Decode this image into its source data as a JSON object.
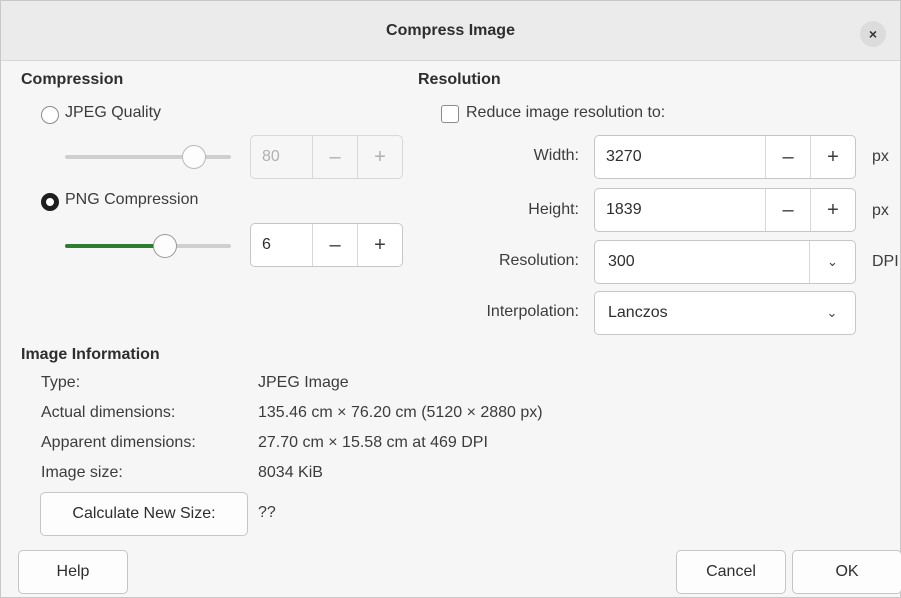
{
  "title": "Compress Image",
  "close_glyph": "×",
  "compression": {
    "heading": "Compression",
    "jpeg_label": "JPEG Quality",
    "jpeg_value": "80",
    "jpeg_slider_fraction": 0.8,
    "png_label": "PNG Compression",
    "png_value": "6",
    "png_slider_fraction": 0.6,
    "selected": "png"
  },
  "resolution": {
    "heading": "Resolution",
    "reduce_label": "Reduce image resolution to:",
    "reduce_checked": false,
    "width_label": "Width:",
    "width_value": "3270",
    "width_unit": "px",
    "height_label": "Height:",
    "height_value": "1839",
    "height_unit": "px",
    "resolution_label": "Resolution:",
    "resolution_value": "300",
    "resolution_unit": "DPI",
    "interpolation_label": "Interpolation:",
    "interpolation_value": "Lanczos"
  },
  "spin": {
    "minus": "–",
    "plus": "+"
  },
  "info": {
    "heading": "Image Information",
    "type_label": "Type:",
    "type_value": "JPEG Image",
    "actual_label": "Actual dimensions:",
    "actual_value": "135.46 cm × 76.20 cm (5120 × 2880 px)",
    "apparent_label": "Apparent dimensions:",
    "apparent_value": "27.70 cm × 15.58 cm at 469 DPI",
    "size_label": "Image size:",
    "size_value": "8034 KiB",
    "calc_button": "Calculate New Size:",
    "calc_result": "??"
  },
  "buttons": {
    "help": "Help",
    "cancel": "Cancel",
    "ok": "OK"
  },
  "icons": {
    "chevron": "⌄",
    "close": "close-icon",
    "dropdown": "chevron-down-icon"
  },
  "colors": {
    "accent": "#2e7d32",
    "radio_selected": "#1e1e1e"
  }
}
